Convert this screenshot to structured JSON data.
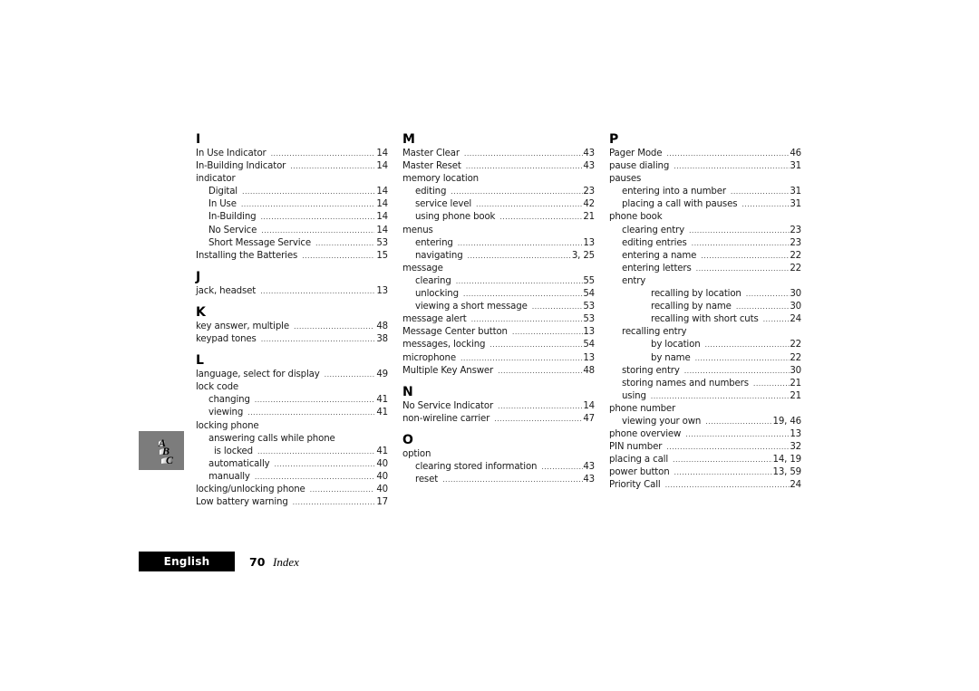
{
  "index": {
    "columns": [
      {
        "sections": [
          {
            "letter": "I",
            "entries": [
              {
                "term": "In Use Indicator",
                "page": "14",
                "level": 0
              },
              {
                "term": "In-Building Indicator",
                "page": "14",
                "level": 0
              },
              {
                "term": "indicator",
                "page": "",
                "level": 0
              },
              {
                "term": "Digital",
                "page": "14",
                "level": 1
              },
              {
                "term": "In Use",
                "page": "14",
                "level": 1
              },
              {
                "term": "In-Building",
                "page": "14",
                "level": 1
              },
              {
                "term": "No Service",
                "page": "14",
                "level": 1
              },
              {
                "term": "Short Message Service",
                "page": "53",
                "level": 1
              },
              {
                "term": "Installing the Batteries",
                "page": "15",
                "level": 0
              }
            ]
          },
          {
            "letter": "J",
            "entries": [
              {
                "term": "jack, headset",
                "page": "13",
                "level": 0
              }
            ]
          },
          {
            "letter": "K",
            "entries": [
              {
                "term": "key answer, multiple",
                "page": "48",
                "level": 0
              },
              {
                "term": "keypad tones",
                "page": "38",
                "level": 0
              }
            ]
          },
          {
            "letter": "L",
            "entries": [
              {
                "term": "language, select for display",
                "page": "49",
                "level": 0
              },
              {
                "term": "lock code",
                "page": "",
                "level": 0
              },
              {
                "term": "changing",
                "page": "41",
                "level": 1
              },
              {
                "term": "viewing",
                "page": "41",
                "level": 1
              },
              {
                "term": "locking phone",
                "page": "",
                "level": 0
              },
              {
                "term": "answering calls while phone",
                "page": "",
                "level": 1
              },
              {
                "term": "is locked",
                "page": "41",
                "level": 3
              },
              {
                "term": "automatically",
                "page": "40",
                "level": 1
              },
              {
                "term": "manually",
                "page": "40",
                "level": 1
              },
              {
                "term": "locking/unlocking phone",
                "page": "40",
                "level": 0
              },
              {
                "term": "Low battery warning",
                "page": "17",
                "level": 0
              }
            ]
          }
        ]
      },
      {
        "sections": [
          {
            "letter": "M",
            "entries": [
              {
                "term": "Master Clear",
                "page": "43",
                "level": 0
              },
              {
                "term": "Master Reset",
                "page": "43",
                "level": 0
              },
              {
                "term": "memory location",
                "page": "",
                "level": 0
              },
              {
                "term": "editing",
                "page": "23",
                "level": 1
              },
              {
                "term": "service level",
                "page": "42",
                "level": 1
              },
              {
                "term": "using phone book",
                "page": "21",
                "level": 1
              },
              {
                "term": "menus",
                "page": "",
                "level": 0
              },
              {
                "term": "entering",
                "page": "13",
                "level": 1
              },
              {
                "term": "navigating",
                "page": "3, 25",
                "level": 1
              },
              {
                "term": "message",
                "page": "",
                "level": 0
              },
              {
                "term": "clearing",
                "page": "55",
                "level": 1
              },
              {
                "term": "unlocking",
                "page": "54",
                "level": 1
              },
              {
                "term": "viewing a short message",
                "page": "53",
                "level": 1
              },
              {
                "term": "message alert",
                "page": "53",
                "level": 0
              },
              {
                "term": "Message Center button",
                "page": "13",
                "level": 0
              },
              {
                "term": "messages, locking",
                "page": "54",
                "level": 0
              },
              {
                "term": "microphone",
                "page": "13",
                "level": 0
              },
              {
                "term": "Multiple Key Answer",
                "page": "48",
                "level": 0
              }
            ]
          },
          {
            "letter": "N",
            "entries": [
              {
                "term": "No Service Indicator",
                "page": "14",
                "level": 0
              },
              {
                "term": "non-wireline carrier",
                "page": "47",
                "level": 0
              }
            ]
          },
          {
            "letter": "O",
            "entries": [
              {
                "term": "option",
                "page": "",
                "level": 0
              },
              {
                "term": "clearing stored information",
                "page": "43",
                "level": 1
              },
              {
                "term": "reset",
                "page": "43",
                "level": 1
              }
            ]
          }
        ]
      },
      {
        "sections": [
          {
            "letter": "P",
            "entries": [
              {
                "term": "Pager Mode",
                "page": "46",
                "level": 0
              },
              {
                "term": "pause dialing",
                "page": "31",
                "level": 0
              },
              {
                "term": "pauses",
                "page": "",
                "level": 0
              },
              {
                "term": "entering into a number",
                "page": "31",
                "level": 1
              },
              {
                "term": "placing a call with pauses",
                "page": "31",
                "level": 1
              },
              {
                "term": "phone book",
                "page": "",
                "level": 0
              },
              {
                "term": "clearing entry",
                "page": "23",
                "level": 1
              },
              {
                "term": "editing entries",
                "page": "23",
                "level": 1
              },
              {
                "term": "entering a name",
                "page": "22",
                "level": 1
              },
              {
                "term": "entering letters",
                "page": "22",
                "level": 1
              },
              {
                "term": "entry",
                "page": "",
                "level": 1
              },
              {
                "term": "recalling by location",
                "page": "30",
                "level": 2
              },
              {
                "term": "recalling by name",
                "page": "30",
                "level": 2
              },
              {
                "term": "recalling with short cuts",
                "page": "24",
                "level": 2
              },
              {
                "term": "recalling entry",
                "page": "",
                "level": 1
              },
              {
                "term": "by location",
                "page": "22",
                "level": 2
              },
              {
                "term": "by name",
                "page": "22",
                "level": 2
              },
              {
                "term": "storing entry",
                "page": "30",
                "level": 1
              },
              {
                "term": "storing names and numbers",
                "page": "21",
                "level": 1
              },
              {
                "term": "using",
                "page": "21",
                "level": 1
              },
              {
                "term": "phone number",
                "page": "",
                "level": 0
              },
              {
                "term": "viewing your own",
                "page": "19, 46",
                "level": 1
              },
              {
                "term": "phone overview",
                "page": "13",
                "level": 0
              },
              {
                "term": "PIN number",
                "page": "32",
                "level": 0
              },
              {
                "term": "placing a call",
                "page": "14, 19",
                "level": 0
              },
              {
                "term": "power button",
                "page": "13, 59",
                "level": 0
              },
              {
                "term": "Priority Call",
                "page": "24",
                "level": 0
              }
            ]
          }
        ]
      }
    ]
  },
  "side_tab": {
    "icon": "abc-index-icon"
  },
  "footer": {
    "language_label": "English",
    "page_number": "70",
    "page_title": "Index"
  },
  "colors": {
    "footer_bar": "#000000",
    "side_tab": "#7c7c7c",
    "text": "#1a1a1a"
  }
}
